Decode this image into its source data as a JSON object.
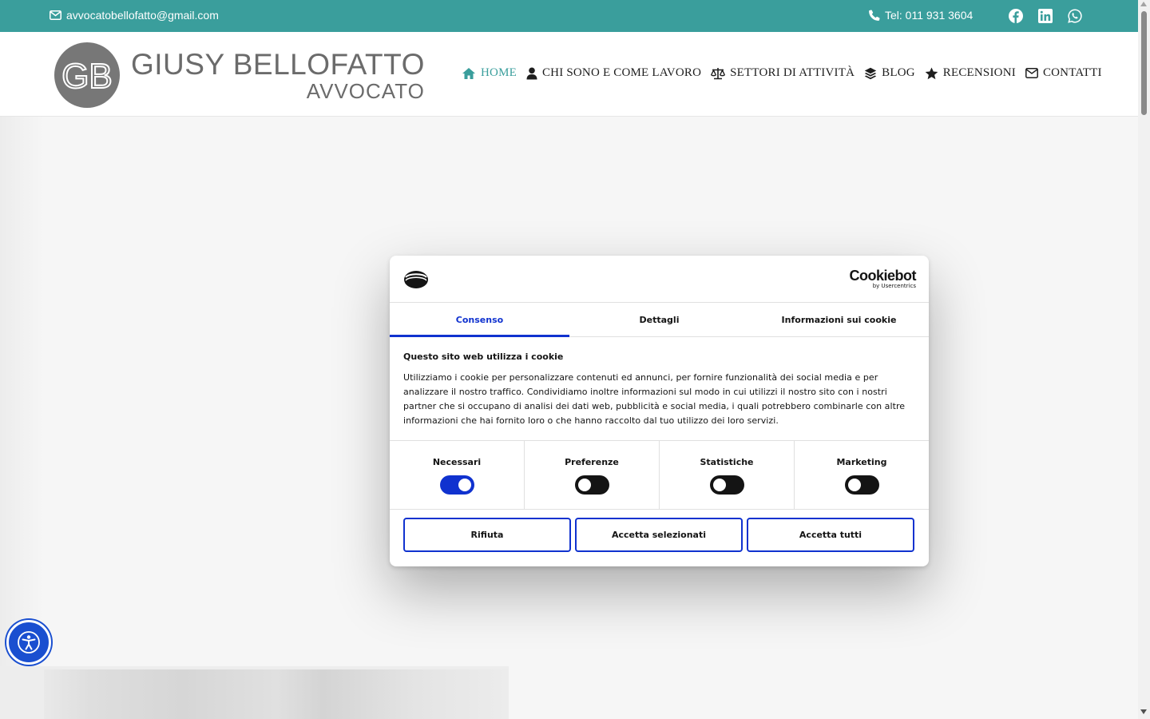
{
  "topbar": {
    "email": "avvocatobellofatto@gmail.com",
    "phone": "Tel: 011 931 3604",
    "socials": [
      "facebook-icon",
      "linkedin-icon",
      "whatsapp-icon"
    ],
    "bg_color": "#3a9e9c"
  },
  "logo": {
    "monogram": "GB",
    "name": "GIUSY BELLOFATTO",
    "subtitle": "AVVOCATO"
  },
  "nav": {
    "items": [
      {
        "label": "HOME",
        "icon": "home-icon",
        "active": true
      },
      {
        "label": "CHI SONO E COME LAVORO",
        "icon": "user-icon"
      },
      {
        "label": "SETTORI DI ATTIVITÀ",
        "icon": "scale-icon"
      },
      {
        "label": "BLOG",
        "icon": "layers-icon"
      },
      {
        "label": "RECENSIONI",
        "icon": "star-icon"
      },
      {
        "label": "CONTATTI",
        "icon": "envelope-icon"
      }
    ],
    "active_color": "#3a9e9c"
  },
  "cookie_dialog": {
    "brand": "Cookiebot",
    "brand_sub": "by Usercentrics",
    "tabs": [
      {
        "label": "Consenso",
        "active": true
      },
      {
        "label": "Dettagli"
      },
      {
        "label": "Informazioni sui cookie"
      }
    ],
    "heading": "Questo sito web utilizza i cookie",
    "text": "Utilizziamo i cookie per personalizzare contenuti ed annunci, per fornire funzionalità dei social media e per analizzare il nostro traffico. Condividiamo inoltre informazioni sul modo in cui utilizzi il nostro sito con i nostri partner che si occupano di analisi dei dati web, pubblicità e social media, i quali potrebbero combinarle con altre informazioni che hai fornito loro o che hanno raccolto dal tuo utilizzo dei loro servizi.",
    "categories": [
      {
        "label": "Necessari",
        "enabled": true
      },
      {
        "label": "Preferenze",
        "enabled": false
      },
      {
        "label": "Statistiche",
        "enabled": false
      },
      {
        "label": "Marketing",
        "enabled": false
      }
    ],
    "buttons": {
      "reject": "Rifiuta",
      "accept_selected": "Accetta selezionati",
      "accept_all": "Accetta tutti"
    },
    "accent_color": "#1032cf"
  },
  "accessibility": {
    "icon": "accessibility-icon",
    "color": "#1a4fd0"
  }
}
